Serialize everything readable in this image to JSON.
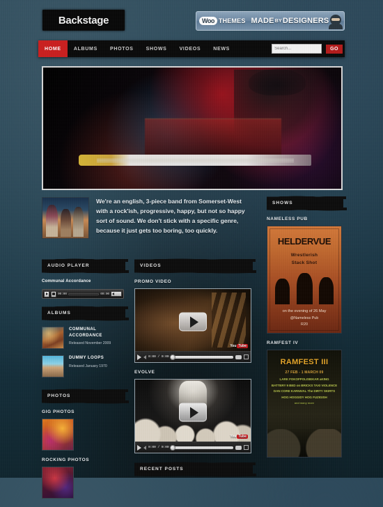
{
  "site": {
    "logo_text": "Backstage"
  },
  "woo_banner": {
    "logo": "Woo",
    "themes": "THEMES",
    "made": "MADE",
    "by": "BY",
    "designers": "DESIGNERS",
    "ninja_icon": "ninja-icon"
  },
  "nav": {
    "items": [
      {
        "label": "HOME",
        "active": true
      },
      {
        "label": "ALBUMS",
        "active": false
      },
      {
        "label": "PHOTOS",
        "active": false
      },
      {
        "label": "SHOWS",
        "active": false
      },
      {
        "label": "VIDEOS",
        "active": false
      },
      {
        "label": "NEWS",
        "active": false
      }
    ],
    "search_placeholder": "Search...",
    "go_label": "GO"
  },
  "hero": {
    "alt": "live concert guitarist under red stage lights"
  },
  "intro": {
    "thumb_alt": "band photo three members at dusk",
    "text": "We're an english, 3-piece band from Somerset-West with a rock'ish, progressive, happy, but not so happy sort of sound. We don't stick with a specific genre, because it just gets too boring, too quickly."
  },
  "audio_player": {
    "heading": "AUDIO PLAYER",
    "track_title": "Communal Accordance",
    "play_icon": "play-icon",
    "stop_icon": "stop-icon",
    "elapsed": "00:00",
    "duration": "00:00",
    "volume_icon": "volume-icon"
  },
  "albums": {
    "heading": "ALBUMS",
    "items": [
      {
        "title": "COMMUNAL ACCORDANCE",
        "released": "Released November 2009"
      },
      {
        "title": "DUMMY LOOPS",
        "released": "Released January 1970"
      }
    ]
  },
  "photos": {
    "heading": "PHOTOS",
    "items": [
      {
        "title": "GIG PHOTOS"
      },
      {
        "title": "ROCKING PHOTOS"
      }
    ]
  },
  "videos": {
    "heading": "VIDEOS",
    "items": [
      {
        "title": "PROMO VIDEO",
        "play_icon": "play-icon",
        "time": "0:00 / 0:00",
        "brand": "You",
        "brand_tube": "Tube"
      },
      {
        "title": "EVOLVE",
        "play_icon": "play-icon",
        "time": "0:00 / 0:00",
        "brand": "You",
        "brand_tube": "Tube"
      }
    ]
  },
  "recent_posts": {
    "heading": "RECENT POSTS"
  },
  "shows": {
    "heading": "SHOWS",
    "items": [
      {
        "venue_label": "NAMELESS PUB",
        "poster": {
          "headline": "HELDERVUE",
          "band_1": "Wrestlerish",
          "band_2": "Stack Shot",
          "footer_1": "on the evening of 26 May",
          "footer_2": "@Nameless Pub",
          "footer_3": "R20"
        }
      },
      {
        "venue_label": "RAMFEST IV",
        "poster": {
          "headline": "RAMFEST III",
          "dates": "27 FEB - 1 MARCH 09",
          "lineup_1": "LARK FOKOFPOLISIEKAR aKING",
          "lineup_2": "BATTERY 9 BED on BRICKS TAXI VIOLENCE",
          "lineup_3": "DAN CORE KARNIVAL The DIRTY SKIRTS",
          "lineup_4": "HOG HOGGIDY HOG FUZIGISH",
          "lineup_5": "and many more"
        }
      }
    ]
  },
  "colors": {
    "accent_red": "#cc1f1f",
    "go_red": "#b51b1b",
    "widget_black": "#0c0c0c",
    "page_bg": "#15323f",
    "text_light": "#e8eef2",
    "poster_orange": "#c26a30",
    "poster_gold": "#e8a82a"
  }
}
